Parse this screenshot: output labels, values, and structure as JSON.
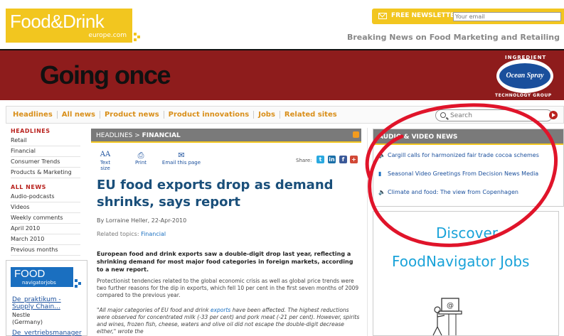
{
  "header": {
    "logo_name": "Food&Drink",
    "logo_sub": "europe.com",
    "newsletter_label": "FREE NEWSLETTER",
    "newsletter_placeholder": "Your email",
    "tagline": "Breaking News on Food Marketing and Retailing"
  },
  "banner": {
    "slogan": "Going once",
    "badge_top": "INGREDIENT",
    "badge_brand": "Ocean Spray",
    "badge_bottom": "TECHNOLOGY GROUP"
  },
  "nav": {
    "items": [
      "Headlines",
      "All news",
      "Product news",
      "Product innovations",
      "Jobs",
      "Related sites"
    ],
    "search_placeholder": "Search"
  },
  "sidebar": {
    "headlines_title": "HEADLINES",
    "headlines": [
      "Retail",
      "Financial",
      "Consumer Trends",
      "Products & Marketing"
    ],
    "allnews_title": "ALL NEWS",
    "allnews": [
      "Audio-podcasts",
      "Videos",
      "Weekly comments",
      "April 2010",
      "March 2010",
      "Previous months"
    ],
    "jobs_logo_big": "FOOD",
    "jobs_logo_small": "navigatorjobs",
    "job1_title": "De_praktikum - Supply Chain...",
    "job1_company": "Nestle",
    "job1_country": "(Germany)",
    "job2_title": "De_vertriebsmanager"
  },
  "article": {
    "crumb_section": "HEADLINES > ",
    "crumb_page": "FINANCIAL",
    "tool_text": "Text size",
    "tool_print": "Print",
    "tool_email": "Email this page",
    "share_label": "Share:",
    "headline": "EU food exports drop as demand shrinks, says report",
    "byline": "By Lorraine Heller, 22-Apr-2010",
    "related_label": "Related topics: ",
    "related_topic": "Financial",
    "lead": "European food and drink exports saw a double-digit drop last year, reflecting a shrinking demand for most major food categories in foreign markets, according to a new report.",
    "body1": "Protectionist tendencies related to the global economic crisis as well as global price trends were two further reasons for the dip in exports, which fell 10 per cent in the first seven months of 2009 compared to the previous year.",
    "body2_pre": "\"All major categories of EU food and drink ",
    "body2_link": "exports",
    "body2_post": " have been affected. The highest reductions were observed for concentrated milk (-33 per cent) and pork meat (-21 per cent). However, spirits and wines, frozen fish, cheese, waters and olive oil did not escape the double-digit decrease either,\" wrote the"
  },
  "audio_video": {
    "title": "AUDIO & VIDEO NEWS",
    "items": [
      "Cargill calls for harmonized fair trade cocoa schemes",
      "Seasonal Video Greetings From Decision News Media",
      "Climate and food: The view from Copenhagen"
    ]
  },
  "promo": {
    "line1": "Discover",
    "line2": "FoodNavigator Jobs"
  },
  "colors": {
    "brand_yellow": "#f2c61f",
    "banner_red": "#8e1c1c",
    "nav_orange": "#d98f1a",
    "headline_blue": "#1a4f7a",
    "annotation_red": "#e0142a"
  }
}
